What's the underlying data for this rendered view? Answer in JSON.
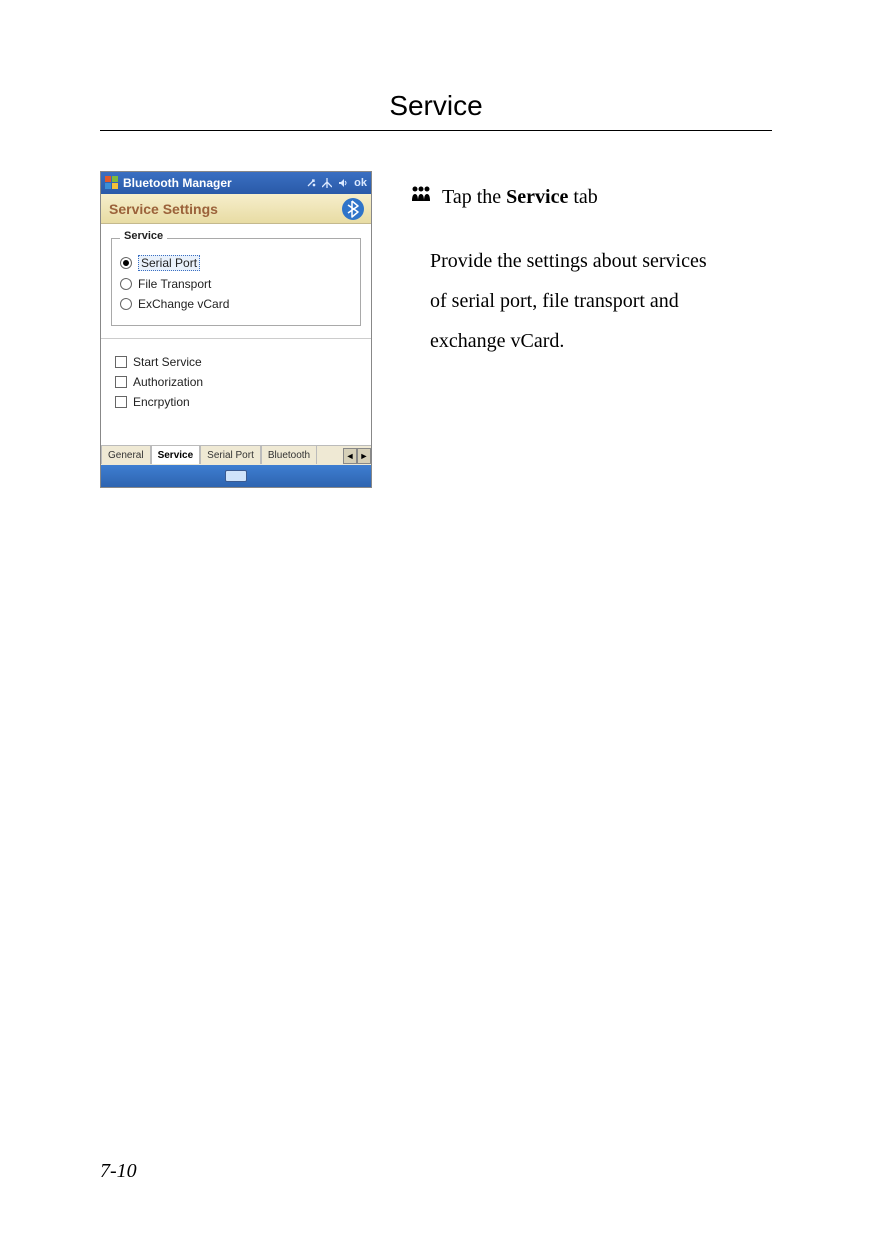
{
  "page": {
    "title": "Service",
    "footer": "7-10"
  },
  "instructions": {
    "bullet_icon_name": "people-icon",
    "tap_prefix": "Tap the ",
    "tap_bold": "Service",
    "tap_suffix": " tab",
    "body_line1": "Provide the settings about services",
    "body_line2": "of serial port, file transport and",
    "body_line3": "exchange vCard."
  },
  "device": {
    "titlebar": {
      "app_name": "Bluetooth Manager",
      "ok_label": "ok"
    },
    "header": {
      "title": "Service Settings"
    },
    "fieldset": {
      "legend": "Service",
      "radios": [
        {
          "label": "Serial Port",
          "selected": true
        },
        {
          "label": "File Transport",
          "selected": false
        },
        {
          "label": "ExChange vCard",
          "selected": false
        }
      ]
    },
    "checks": [
      {
        "label": "Start Service"
      },
      {
        "label": "Authorization"
      },
      {
        "label": "Encrpytion"
      }
    ],
    "tabs": {
      "items": [
        "General",
        "Service",
        "Serial Port",
        "Bluetooth"
      ],
      "active_index": 1
    }
  }
}
